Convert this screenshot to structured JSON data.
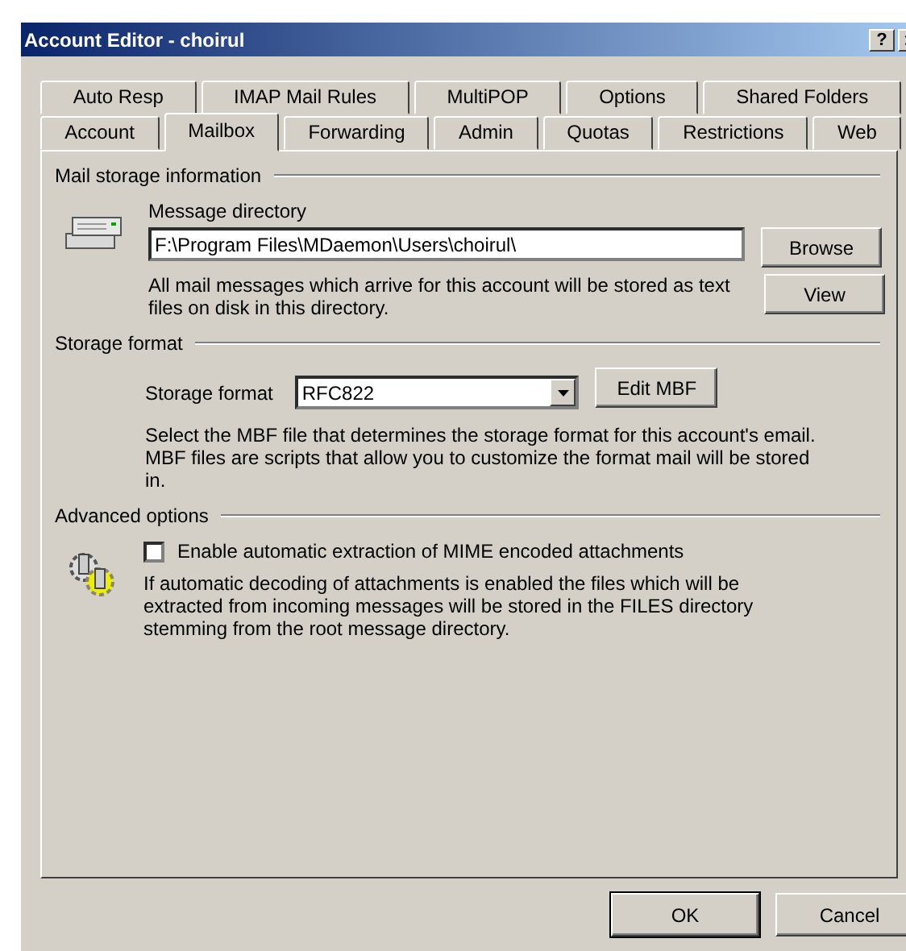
{
  "window": {
    "title": "Account Editor - choirul",
    "help_button": "?"
  },
  "tab_rows": [
    {
      "tabs": [
        {
          "label": "Auto Resp",
          "selected": false
        },
        {
          "label": "IMAP Mail Rules",
          "selected": false
        },
        {
          "label": "MultiPOP",
          "selected": false
        },
        {
          "label": "Options",
          "selected": false
        },
        {
          "label": "Shared Folders",
          "selected": false
        }
      ]
    },
    {
      "tabs": [
        {
          "label": "Account",
          "selected": false
        },
        {
          "label": "Mailbox",
          "selected": true
        },
        {
          "label": "Forwarding",
          "selected": false
        },
        {
          "label": "Admin",
          "selected": false
        },
        {
          "label": "Quotas",
          "selected": false
        },
        {
          "label": "Restrictions",
          "selected": false
        },
        {
          "label": "Web",
          "selected": false
        }
      ]
    }
  ],
  "mail_storage": {
    "heading": "Mail storage information",
    "label": "Message directory",
    "value": "F:\\Program Files\\MDaemon\\Users\\choirul\\",
    "buttons": [
      "Browse",
      "View"
    ],
    "description": "All mail messages which arrive for this account will be stored as text files on disk in this directory."
  },
  "storage_format": {
    "heading": "Storage format",
    "label": "Storage format",
    "value": "RFC822",
    "button": "Edit MBF",
    "description": "Select the MBF file that determines the storage format for this account's email.  MBF files are scripts that allow you to customize the format mail will be stored in."
  },
  "advanced": {
    "heading": "Advanced options",
    "checkbox": {
      "label": "Enable automatic extraction of MIME encoded attachments",
      "checked": false
    },
    "description": "If automatic decoding of attachments is enabled the files which will be extracted from incoming messages will be stored in the FILES directory stemming from the root message directory."
  },
  "buttons": [
    "OK",
    "Cancel"
  ]
}
